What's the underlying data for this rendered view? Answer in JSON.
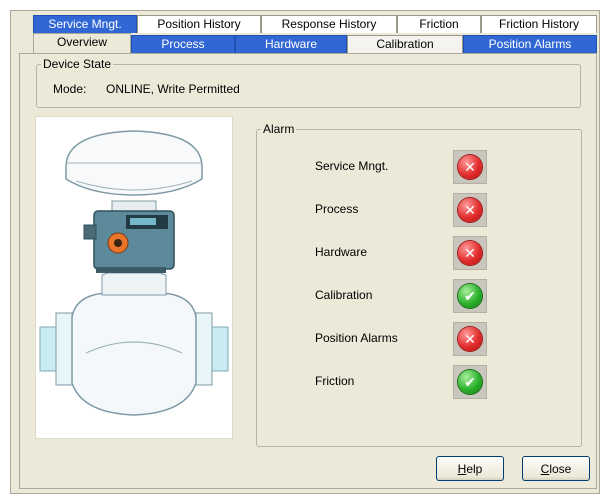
{
  "tabs_back": [
    {
      "label": "Service Mngt.",
      "style": "blue"
    },
    {
      "label": "Position History",
      "style": "white"
    },
    {
      "label": "Response History",
      "style": "white"
    },
    {
      "label": "Friction",
      "style": "white"
    },
    {
      "label": "Friction History",
      "style": "white"
    }
  ],
  "tabs_front": [
    {
      "label": "Overview",
      "style": "active"
    },
    {
      "label": "Process",
      "style": "blue"
    },
    {
      "label": "Hardware",
      "style": "blue"
    },
    {
      "label": "Calibration",
      "style": "cream"
    },
    {
      "label": "Position Alarms",
      "style": "blue"
    }
  ],
  "device_state": {
    "title": "Device State",
    "mode_label": "Mode:",
    "mode_value": "ONLINE, Write Permitted"
  },
  "alarm": {
    "title": "Alarm",
    "items": [
      {
        "label": "Service Mngt.",
        "status": "fail",
        "icon": "red-x-icon"
      },
      {
        "label": "Process",
        "status": "fail",
        "icon": "red-x-icon"
      },
      {
        "label": "Hardware",
        "status": "fail",
        "icon": "red-x-icon"
      },
      {
        "label": "Calibration",
        "status": "ok",
        "icon": "green-check-icon"
      },
      {
        "label": "Position Alarms",
        "status": "fail",
        "icon": "red-x-icon"
      },
      {
        "label": "Friction",
        "status": "ok",
        "icon": "green-check-icon"
      }
    ]
  },
  "buttons": {
    "help": {
      "mnemonic": "H",
      "rest": "elp"
    },
    "close": {
      "mnemonic": "C",
      "rest": "lose"
    }
  },
  "colors": {
    "tab_blue": "#3167d4",
    "dialog_bg": "#ece9d8",
    "fail": "#e22d2d",
    "ok": "#2bb12b"
  }
}
